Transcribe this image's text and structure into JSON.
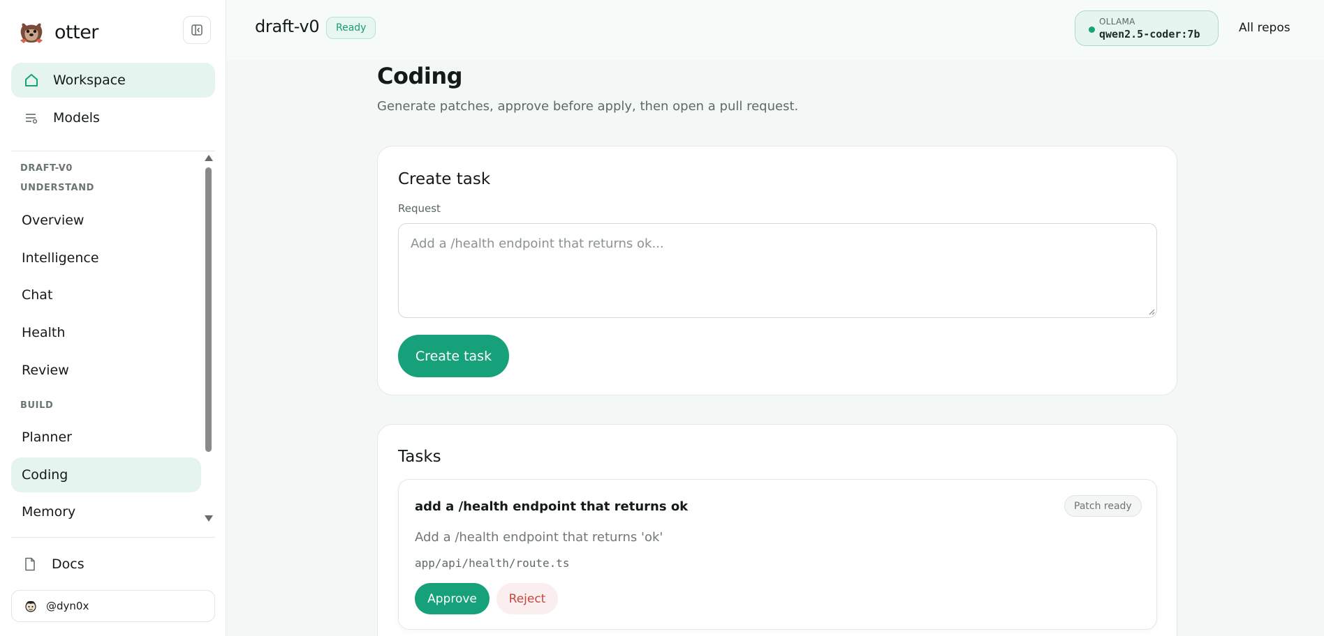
{
  "brand": {
    "name": "otter"
  },
  "nav": {
    "workspace": "Workspace",
    "models": "Models",
    "project_label": "DRAFT-V0",
    "understand_label": "UNDERSTAND",
    "understand_items": [
      "Overview",
      "Intelligence",
      "Chat",
      "Health",
      "Review"
    ],
    "build_label": "BUILD",
    "build_items": [
      "Planner",
      "Coding",
      "Memory"
    ],
    "docs": "Docs",
    "user": "@dyn0x"
  },
  "header": {
    "project": "draft-v0",
    "status": "Ready",
    "model_provider": "OLLAMA",
    "model_name": "qwen2.5-coder:7b",
    "all_repos": "All repos"
  },
  "page": {
    "title": "Coding",
    "subtitle": "Generate patches, approve before apply, then open a pull request."
  },
  "create_task": {
    "title": "Create task",
    "request_label": "Request",
    "request_placeholder": "Add a /health endpoint that returns ok...",
    "button": "Create task"
  },
  "tasks": {
    "title": "Tasks",
    "items": [
      {
        "title": "add a /health endpoint that returns ok",
        "status": "Patch ready",
        "description": "Add a /health endpoint that returns 'ok'",
        "file": "app/api/health/route.ts",
        "approve": "Approve",
        "reject": "Reject"
      }
    ]
  },
  "colors": {
    "accent": "#17a17a",
    "accent_soft": "#e5f4ee",
    "danger": "#c0493f"
  }
}
